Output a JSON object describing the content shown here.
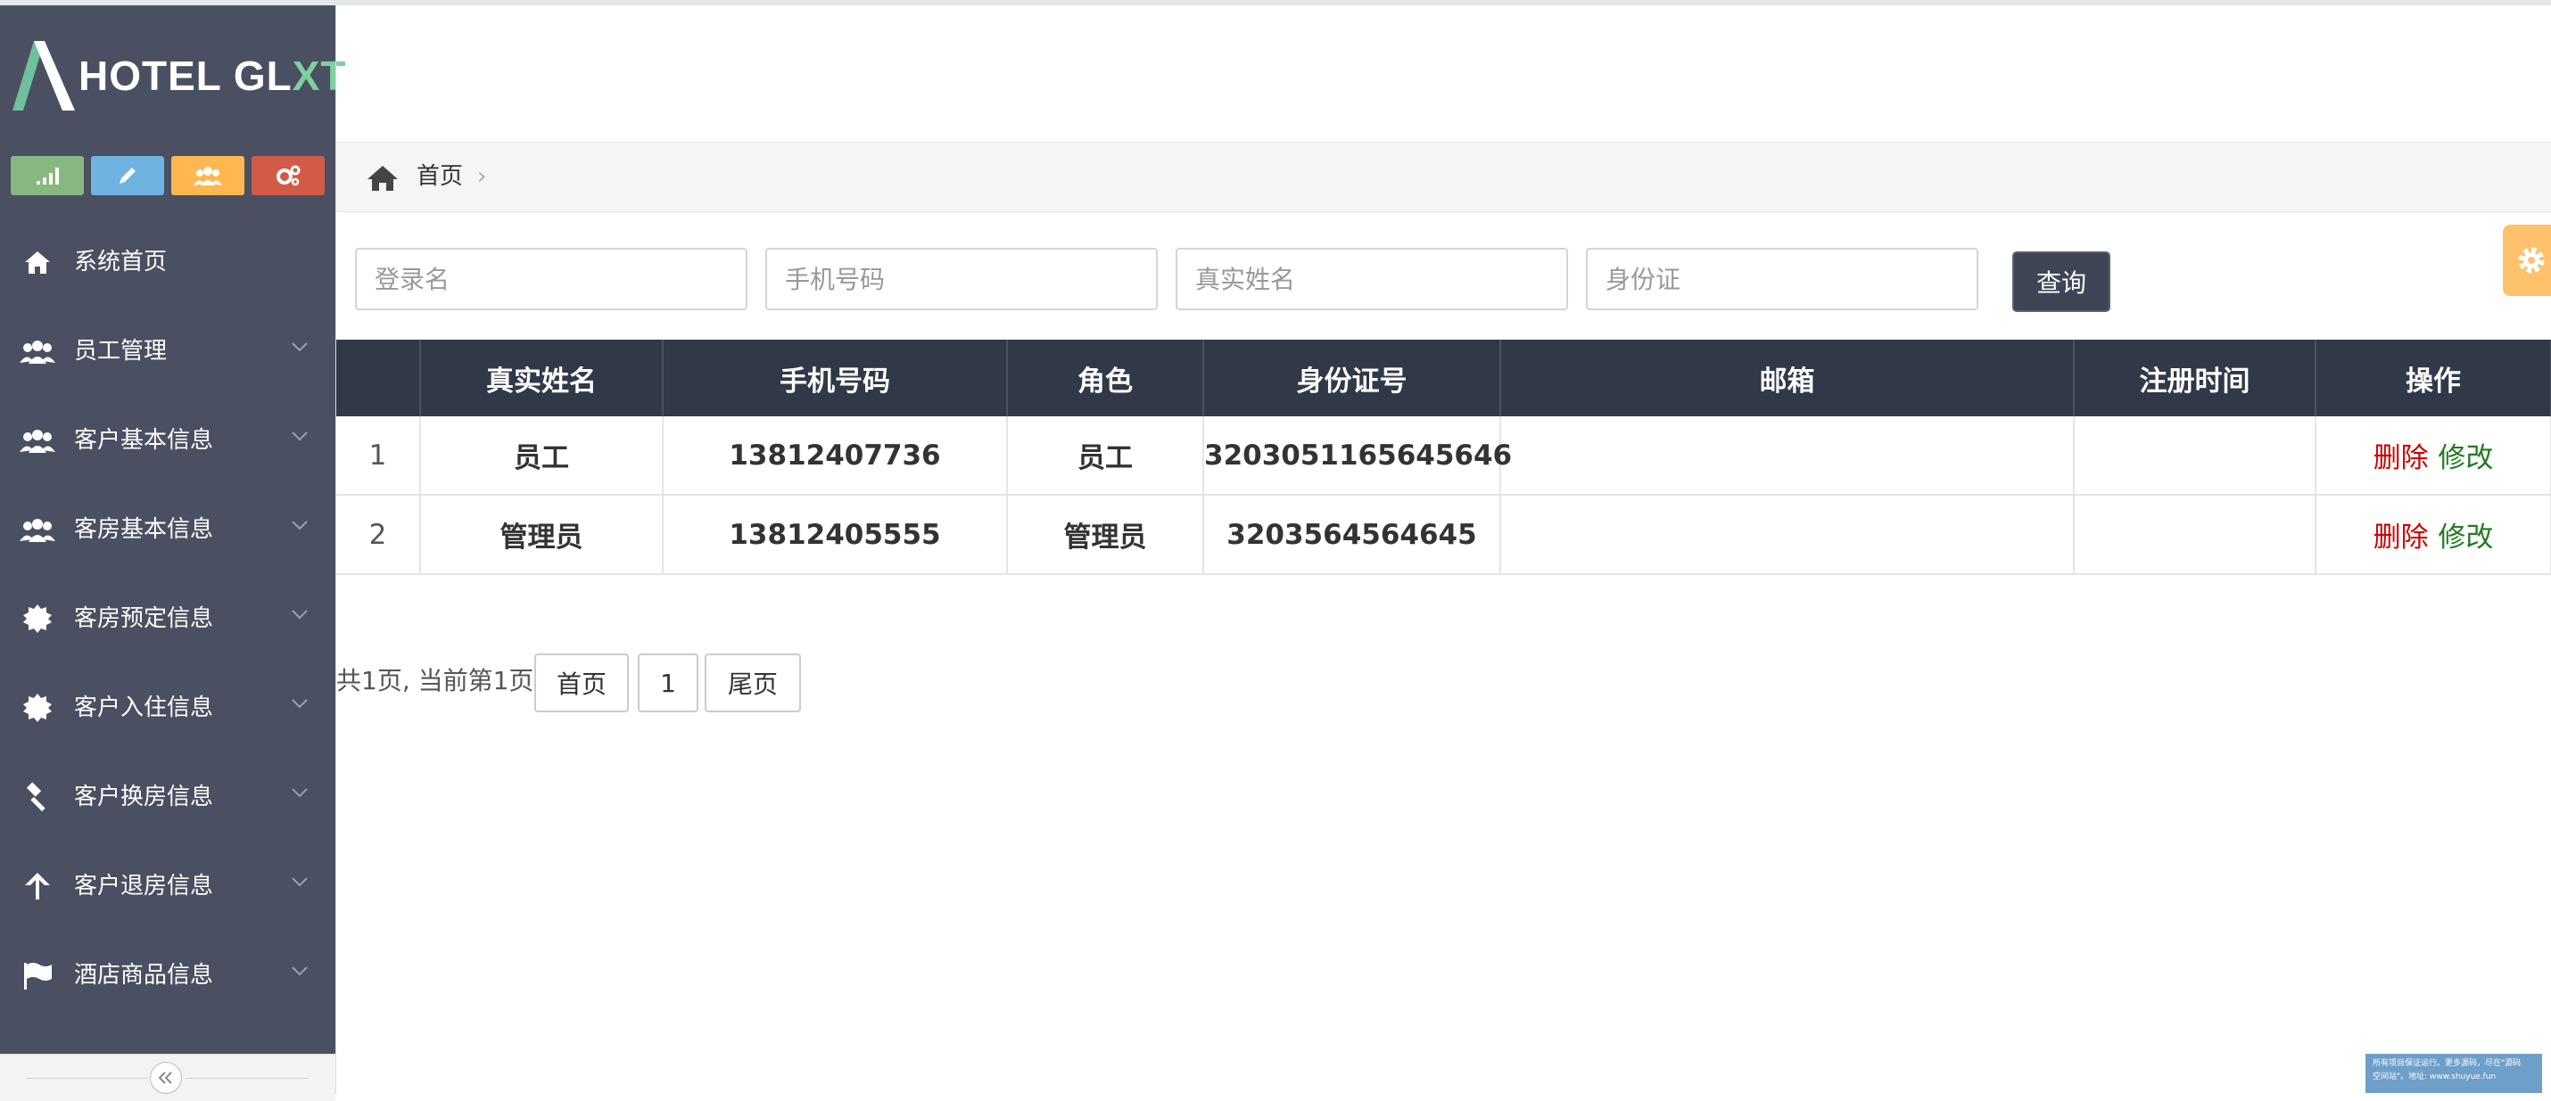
{
  "brand": {
    "text_main": "HOTEL GL",
    "text_x": "X",
    "text_tail": "T"
  },
  "shortcuts": [
    {
      "icon": "signal-icon",
      "color": "#87b87f"
    },
    {
      "icon": "pencil-icon",
      "color": "#6fb3e0"
    },
    {
      "icon": "users-icon",
      "color": "#ffb752"
    },
    {
      "icon": "cogs-icon",
      "color": "#d15b47"
    }
  ],
  "sidebar": {
    "items": [
      {
        "label": "系统首页",
        "icon": "home-icon",
        "has_submenu": false
      },
      {
        "label": "员工管理",
        "icon": "users-icon",
        "has_submenu": true
      },
      {
        "label": "客户基本信息",
        "icon": "users-icon",
        "has_submenu": true
      },
      {
        "label": "客房基本信息",
        "icon": "users-icon",
        "has_submenu": true
      },
      {
        "label": "客房预定信息",
        "icon": "badge-icon",
        "has_submenu": true
      },
      {
        "label": "客户入住信息",
        "icon": "badge-icon",
        "has_submenu": true
      },
      {
        "label": "客户换房信息",
        "icon": "gavel-icon",
        "has_submenu": true
      },
      {
        "label": "客户退房信息",
        "icon": "arrow-up-icon",
        "has_submenu": true
      },
      {
        "label": "酒店商品信息",
        "icon": "flag-icon",
        "has_submenu": true
      }
    ]
  },
  "breadcrumb": {
    "home": "首页",
    "separator": "›"
  },
  "search": {
    "login_placeholder": "登录名",
    "phone_placeholder": "手机号码",
    "name_placeholder": "真实姓名",
    "idcard_placeholder": "身份证",
    "button": "查询"
  },
  "table": {
    "headers": [
      "",
      "真实姓名",
      "手机号码",
      "角色",
      "身份证号",
      "邮箱",
      "注册时间",
      "操作"
    ],
    "rows": [
      {
        "idx": "1",
        "name": "员工",
        "phone": "13812407736",
        "role": "员工",
        "idcard": "3203051165645646",
        "email": "",
        "registered": "",
        "delete": "删除",
        "edit": "修改"
      },
      {
        "idx": "2",
        "name": "管理员",
        "phone": "13812405555",
        "role": "管理员",
        "idcard": "3203564564645",
        "email": "",
        "registered": "",
        "delete": "删除",
        "edit": "修改"
      }
    ]
  },
  "pagination": {
    "info": "共1页, 当前第1页",
    "first": "首页",
    "current": "1",
    "last": "尾页"
  },
  "watermark": {
    "line1": "所有项目保证运行。更多源码，尽在\"源码",
    "line2": "空间站\"。地址: www.shuyue.fun"
  },
  "colors": {
    "sidebar_bg": "#4a5061",
    "table_header_bg": "#313847",
    "delete_link": "#d00000",
    "edit_link": "#1e7d1e"
  }
}
